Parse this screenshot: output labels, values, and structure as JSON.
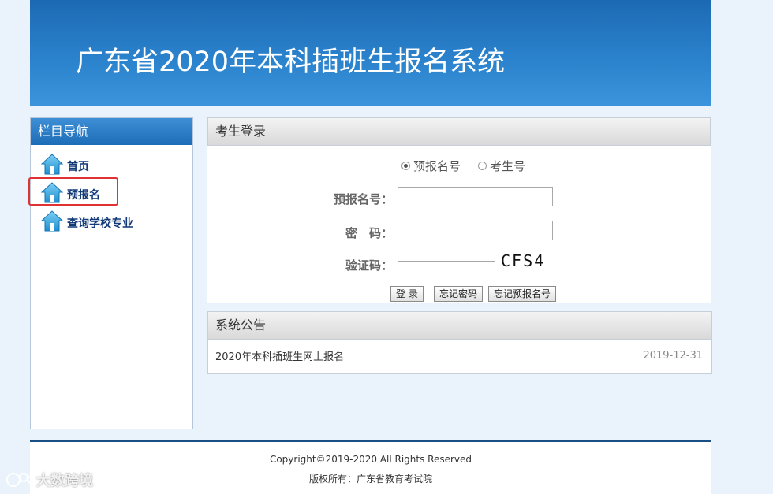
{
  "header": {
    "title": "广东省2020年本科插班生报名系统"
  },
  "sidebar": {
    "title": "栏目导航",
    "items": [
      {
        "label": "首页",
        "icon": "home-icon"
      },
      {
        "label": "预报名",
        "icon": "home-icon"
      },
      {
        "label": "查询学校专业",
        "icon": "home-icon"
      }
    ]
  },
  "login": {
    "title": "考生登录",
    "radio_options": [
      {
        "label": "预报名号",
        "checked": true
      },
      {
        "label": "考生号",
        "checked": false
      }
    ],
    "fields": {
      "id_label": "预报名号：",
      "password_label": "密　码：",
      "captcha_label": "验证码：",
      "id_value": "",
      "password_value": "",
      "captcha_value": ""
    },
    "captcha_text": "CFS4",
    "buttons": {
      "login": "登 录",
      "forgot_password": "忘记密码",
      "forgot_id": "忘记预报名号"
    }
  },
  "notice": {
    "title": "系统公告",
    "items": [
      {
        "text": "2020年本科插班生网上报名",
        "date": "2019-12-31"
      }
    ]
  },
  "footer": {
    "copyright": "Copyright©2019-2020 All Rights Reserved",
    "owner": "版权所有：广东省教育考试院"
  },
  "watermark": {
    "text": "大数跨境"
  },
  "colors": {
    "banner": "#2b82cc",
    "sidebar_header": "#1d6cb7",
    "nav_text": "#123a78",
    "highlight": "#e03232",
    "footer_border": "#1a4f86"
  }
}
